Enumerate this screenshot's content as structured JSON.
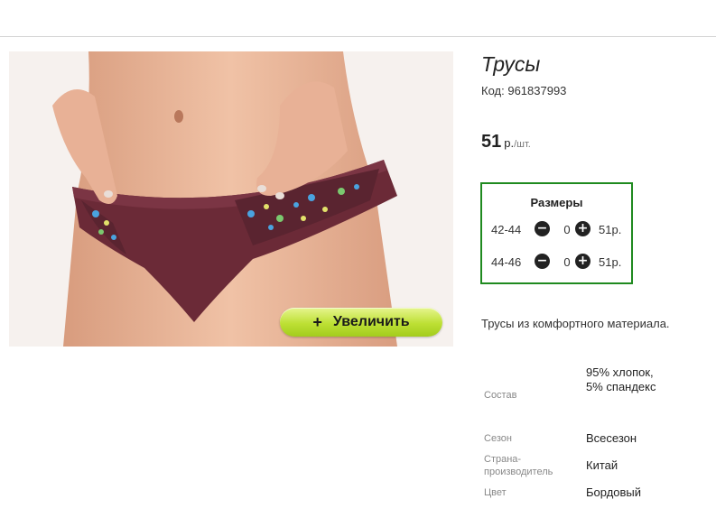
{
  "product": {
    "title": "Трусы",
    "code_label": "Код:",
    "code": "961837993",
    "price": "51",
    "currency": "р.",
    "unit": "/шт.",
    "zoom_button": "Увеличить",
    "zoom_icon": "plus-icon",
    "description": "Трусы из комфортного материала."
  },
  "sizes": {
    "title": "Размеры",
    "rows": [
      {
        "size": "42-44",
        "qty": "0",
        "price": "51р."
      },
      {
        "size": "44-46",
        "qty": "0",
        "price": "51р."
      }
    ],
    "minus_icon": "minus-circle-icon",
    "plus_icon": "plus-circle-icon",
    "border_color": "#1f8a1f"
  },
  "attributes": [
    {
      "label": "Состав",
      "value": "95% хлопок, 5% спандекс"
    },
    {
      "label": "Сезон",
      "value": "Всесезон"
    },
    {
      "label": "Страна-производитель",
      "value": "Китай"
    },
    {
      "label": "Цвет",
      "value": "Бордовый"
    }
  ],
  "colors": {
    "zoom_button": "#bde034",
    "product_fabric": "#6b2a37"
  }
}
